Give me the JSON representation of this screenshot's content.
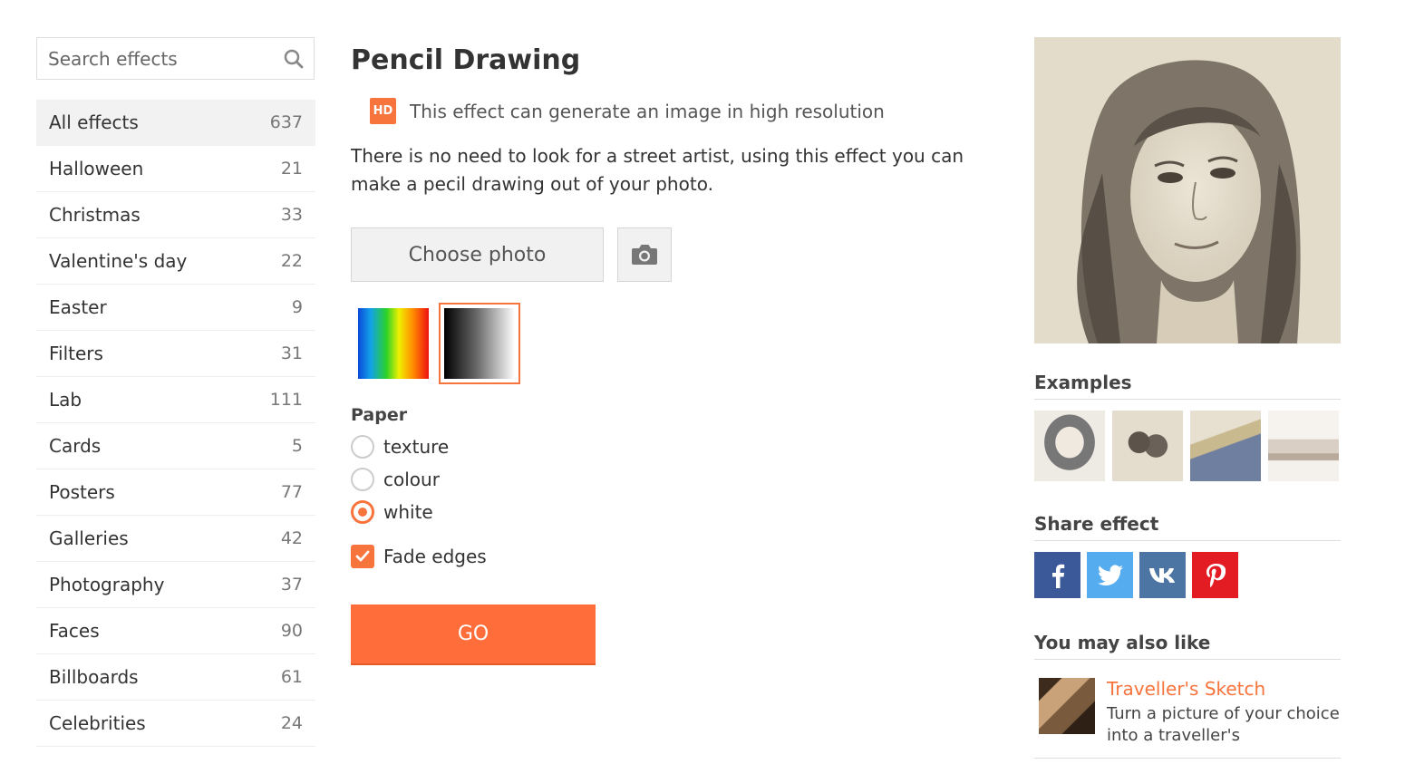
{
  "search": {
    "placeholder": "Search effects",
    "icon": "search-icon"
  },
  "categories": [
    {
      "label": "All effects",
      "count": "637",
      "active": true
    },
    {
      "label": "Halloween",
      "count": "21"
    },
    {
      "label": "Christmas",
      "count": "33"
    },
    {
      "label": "Valentine's day",
      "count": "22"
    },
    {
      "label": "Easter",
      "count": "9"
    },
    {
      "label": "Filters",
      "count": "31"
    },
    {
      "label": "Lab",
      "count": "111"
    },
    {
      "label": "Cards",
      "count": "5"
    },
    {
      "label": "Posters",
      "count": "77"
    },
    {
      "label": "Galleries",
      "count": "42"
    },
    {
      "label": "Photography",
      "count": "37"
    },
    {
      "label": "Faces",
      "count": "90"
    },
    {
      "label": "Billboards",
      "count": "61"
    },
    {
      "label": "Celebrities",
      "count": "24"
    }
  ],
  "main": {
    "title": "Pencil Drawing",
    "hd_badge": "HD",
    "hd_text": "This effect can generate an image in high resolution",
    "description": "There is no need to look for a street artist, using this effect you can make a pecil drawing out of your photo.",
    "choose_label": "Choose photo",
    "paper_label": "Paper",
    "paper_options": [
      "texture",
      "colour",
      "white"
    ],
    "paper_selected": "white",
    "fade_label": "Fade edges",
    "fade_checked": true,
    "go_label": "GO",
    "selected_swatch": "black-white"
  },
  "right": {
    "examples_title": "Examples",
    "share_title": "Share effect",
    "share_icons": [
      "facebook-icon",
      "twitter-icon",
      "vk-icon",
      "pinterest-icon"
    ],
    "like_title": "You may also like",
    "like_name": "Traveller's Sketch",
    "like_desc": "Turn a picture of your choice into a traveller's"
  },
  "colors": {
    "accent": "#f7743d",
    "go": "#ff6e3a",
    "facebook": "#3b5998",
    "twitter": "#55acee",
    "vk": "#4c75a3",
    "pinterest": "#e31b23"
  }
}
